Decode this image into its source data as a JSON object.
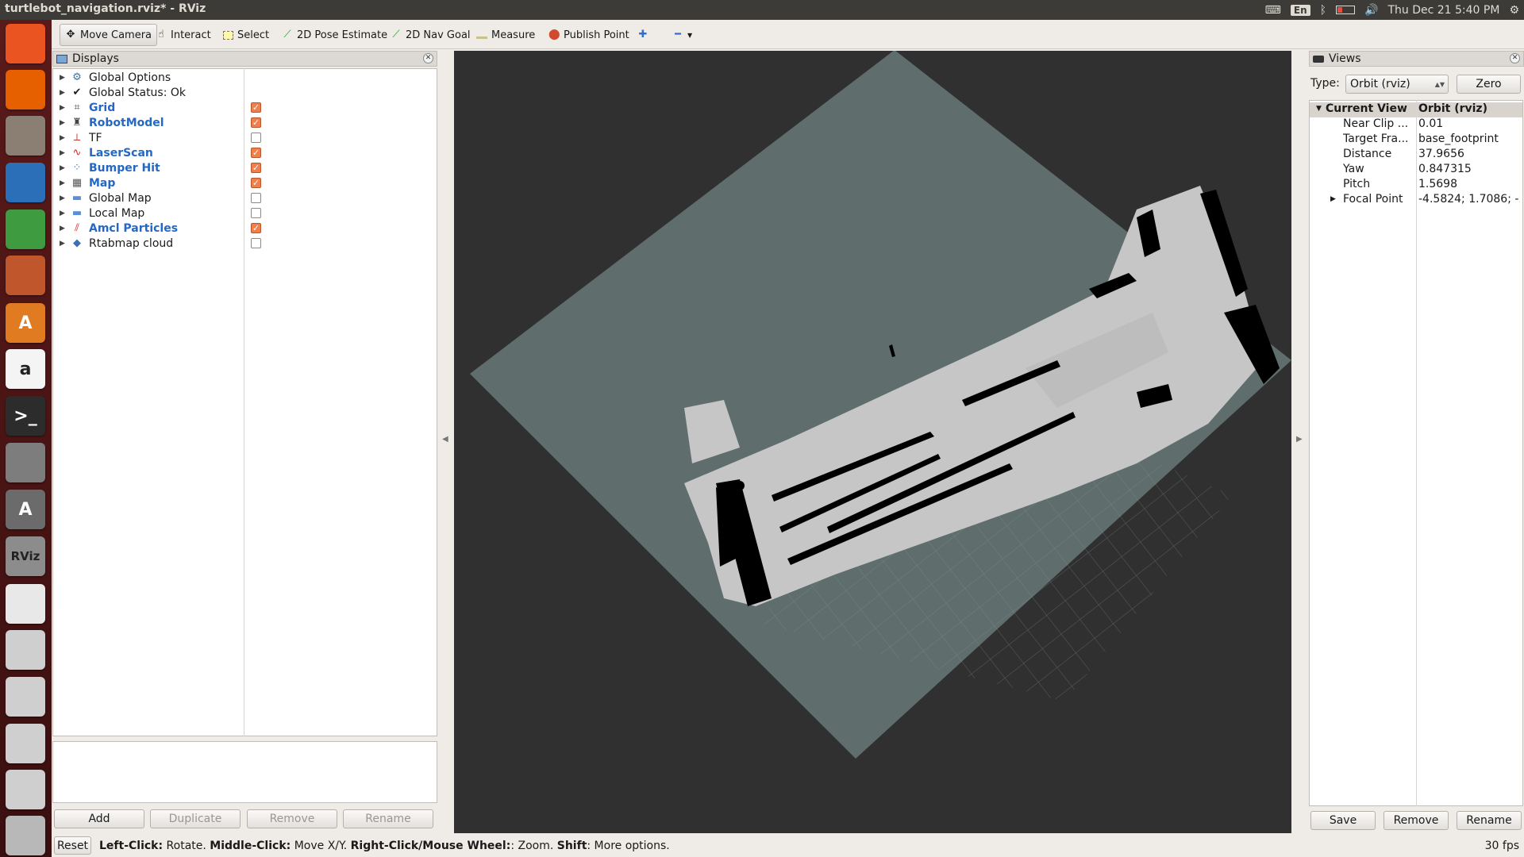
{
  "window": {
    "title": "turtlebot_navigation.rviz* - RViz"
  },
  "topbar": {
    "lang": "En",
    "clock": "Thu Dec 21  5:40 PM"
  },
  "launcher": {
    "items": [
      {
        "name": "ubuntu-dash",
        "label": "",
        "color": "#e95420"
      },
      {
        "name": "firefox",
        "label": "",
        "color": "#e66000"
      },
      {
        "name": "files",
        "label": "",
        "color": "#8a7f72"
      },
      {
        "name": "writer",
        "label": "",
        "color": "#2a6fb8"
      },
      {
        "name": "calc",
        "label": "",
        "color": "#3f9b3f"
      },
      {
        "name": "impress",
        "label": "",
        "color": "#c0562b"
      },
      {
        "name": "software-center",
        "label": "A",
        "color": "#e07b21"
      },
      {
        "name": "amazon",
        "label": "a",
        "color": "#f4f4f4"
      },
      {
        "name": "terminal",
        "label": ">_",
        "color": "#2c2c2c"
      },
      {
        "name": "system-settings",
        "label": "",
        "color": "#7d7d7d"
      },
      {
        "name": "software-updater",
        "label": "A",
        "color": "#6b6b6b"
      },
      {
        "name": "rviz",
        "label": "RViz",
        "color": "#8c8c8c"
      },
      {
        "name": "chrome",
        "label": "",
        "color": "#e8e8e8"
      },
      {
        "name": "drive-1",
        "label": "",
        "color": "#cfcfcf"
      },
      {
        "name": "drive-2",
        "label": "",
        "color": "#cfcfcf"
      },
      {
        "name": "drive-3",
        "label": "",
        "color": "#cfcfcf"
      },
      {
        "name": "drive-4",
        "label": "",
        "color": "#cfcfcf"
      },
      {
        "name": "trash",
        "label": "",
        "color": "#b8b8b8"
      }
    ]
  },
  "toolbar": {
    "move_camera": "Move Camera",
    "interact": "Interact",
    "select": "Select",
    "pose_estimate": "2D Pose Estimate",
    "nav_goal": "2D Nav Goal",
    "measure": "Measure",
    "publish_point": "Publish Point"
  },
  "displays": {
    "title": "Displays",
    "items": [
      {
        "label": "Global Options",
        "icon": "gear-icon",
        "highlight": false,
        "checkbox": null
      },
      {
        "label": "Global Status: Ok",
        "icon": "check-icon",
        "highlight": false,
        "checkbox": null
      },
      {
        "label": "Grid",
        "icon": "grid-icon",
        "highlight": true,
        "checkbox": true
      },
      {
        "label": "RobotModel",
        "icon": "robot-icon",
        "highlight": true,
        "checkbox": true
      },
      {
        "label": "TF",
        "icon": "axes-icon",
        "highlight": false,
        "checkbox": false
      },
      {
        "label": "LaserScan",
        "icon": "laser-icon",
        "highlight": true,
        "checkbox": true
      },
      {
        "label": "Bumper Hit",
        "icon": "points-icon",
        "highlight": true,
        "checkbox": true
      },
      {
        "label": "Map",
        "icon": "map-icon",
        "highlight": true,
        "checkbox": true
      },
      {
        "label": "Global Map",
        "icon": "folder-icon",
        "highlight": false,
        "checkbox": false
      },
      {
        "label": "Local Map",
        "icon": "folder-icon",
        "highlight": false,
        "checkbox": false
      },
      {
        "label": "Amcl Particles",
        "icon": "pose-array-icon",
        "highlight": true,
        "checkbox": true
      },
      {
        "label": "Rtabmap cloud",
        "icon": "pointcloud-icon",
        "highlight": false,
        "checkbox": false
      }
    ],
    "buttons": {
      "add": "Add",
      "duplicate": "Duplicate",
      "remove": "Remove",
      "rename": "Rename"
    }
  },
  "views": {
    "title": "Views",
    "type_label": "Type:",
    "type_value": "Orbit (rviz)",
    "zero": "Zero",
    "current_view": {
      "key": "Current View",
      "value": "Orbit (rviz)"
    },
    "props": [
      {
        "key": "Near Clip ...",
        "value": "0.01"
      },
      {
        "key": "Target Fra...",
        "value": "base_footprint"
      },
      {
        "key": "Distance",
        "value": "37.9656"
      },
      {
        "key": "Yaw",
        "value": "0.847315"
      },
      {
        "key": "Pitch",
        "value": "1.5698"
      },
      {
        "key": "Focal Point",
        "value": "-4.5824; 1.7086; -..."
      }
    ],
    "buttons": {
      "save": "Save",
      "remove": "Remove",
      "rename": "Rename"
    }
  },
  "status": {
    "reset": "Reset",
    "left_click": "Left-Click:",
    "left_desc": " Rotate. ",
    "middle_click": "Middle-Click:",
    "middle_desc": " Move X/Y. ",
    "right_click": "Right-Click/Mouse Wheel:",
    "right_desc": ": Zoom. ",
    "shift": "Shift",
    "shift_desc": ": More options.",
    "fps": "30 fps"
  },
  "colors": {
    "map_unknown": "#5f6e6c",
    "map_free": "#c6c6c6",
    "map_occupied": "#000000",
    "viewport_bg": "#303030",
    "highlight_blue": "#2568c4",
    "checkbox_on": "#ef7f4c"
  }
}
